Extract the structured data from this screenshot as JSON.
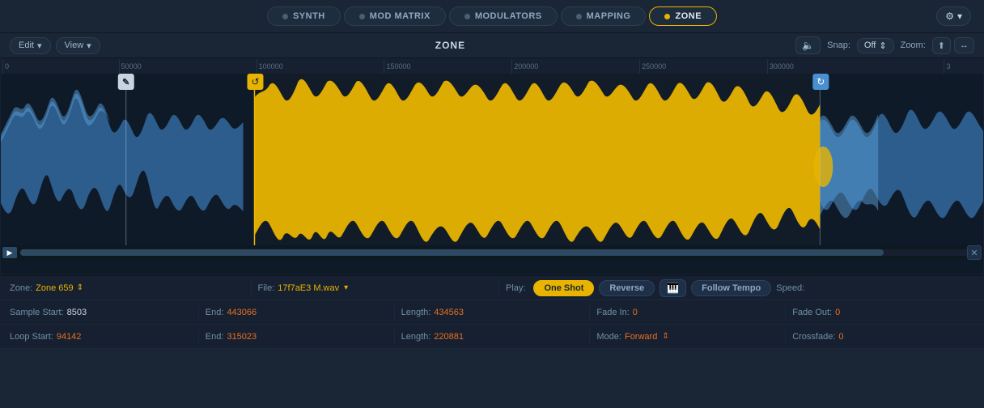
{
  "tabs": [
    {
      "id": "synth",
      "label": "SYNTH",
      "active": false
    },
    {
      "id": "mod-matrix",
      "label": "MOD MATRIX",
      "active": false
    },
    {
      "id": "modulators",
      "label": "MODULATORS",
      "active": false
    },
    {
      "id": "mapping",
      "label": "MAPPING",
      "active": false
    },
    {
      "id": "zone",
      "label": "ZONE",
      "active": true
    }
  ],
  "toolbar": {
    "edit_label": "Edit",
    "view_label": "View",
    "title": "ZONE",
    "snap_label": "Snap:",
    "snap_value": "Off",
    "zoom_label": "Zoom:"
  },
  "zone_info": {
    "zone_label": "Zone:",
    "zone_value": "Zone 659",
    "file_label": "File:",
    "file_value": "17f7aE3 M.wav",
    "play_label": "Play:",
    "play_one_shot": "One Shot",
    "play_reverse": "Reverse",
    "follow_tempo": "Follow Tempo",
    "speed_label": "Speed:"
  },
  "sample_info": {
    "sample_start_label": "Sample Start:",
    "sample_start_value": "8503",
    "end_label": "End:",
    "end_value": "443066",
    "length_label": "Length:",
    "length_value": "434563",
    "fade_in_label": "Fade In:",
    "fade_in_value": "0",
    "fade_out_label": "Fade Out:",
    "fade_out_value": "0"
  },
  "loop_info": {
    "loop_start_label": "Loop Start:",
    "loop_start_value": "94142",
    "end_label": "End:",
    "end_value": "315023",
    "length_label": "Length:",
    "length_value": "220881",
    "mode_label": "Mode:",
    "mode_value": "Forward",
    "crossfade_label": "Crossfade:",
    "crossfade_value": "0"
  },
  "ruler": {
    "marks": [
      "0",
      "50000",
      "100000",
      "150000",
      "200000",
      "250000",
      "300000",
      "3"
    ]
  },
  "colors": {
    "accent": "#e8b400",
    "blue": "#4a90d0",
    "waveform_yellow": "#e8b400",
    "waveform_blue": "#4a8fc8",
    "bg_dark": "#0f1a28"
  }
}
